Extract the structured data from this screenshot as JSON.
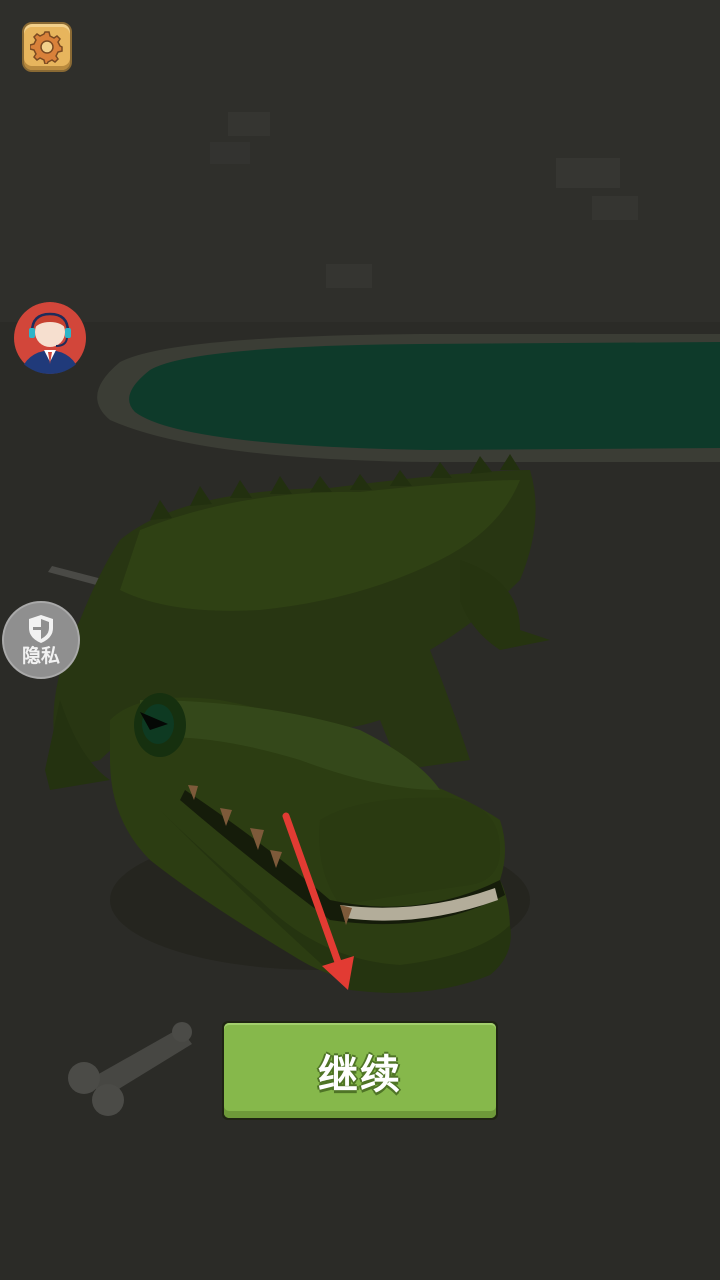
{
  "hud": {
    "settings_icon": "gear-icon",
    "support_icon": "customer-service-avatar",
    "privacy_icon": "shield-icon",
    "privacy_label": "隐私"
  },
  "continue_button": {
    "label": "继续"
  },
  "hint": {
    "icon": "red-arrow-pointing-down"
  },
  "colors": {
    "background": "#2b2b27",
    "pond_water": "#0e3a2a",
    "crocodile": "#2c3d12",
    "button_green": "#86b84b",
    "settings_orange": "#e7b55d",
    "arrow_red": "#e23b33"
  }
}
